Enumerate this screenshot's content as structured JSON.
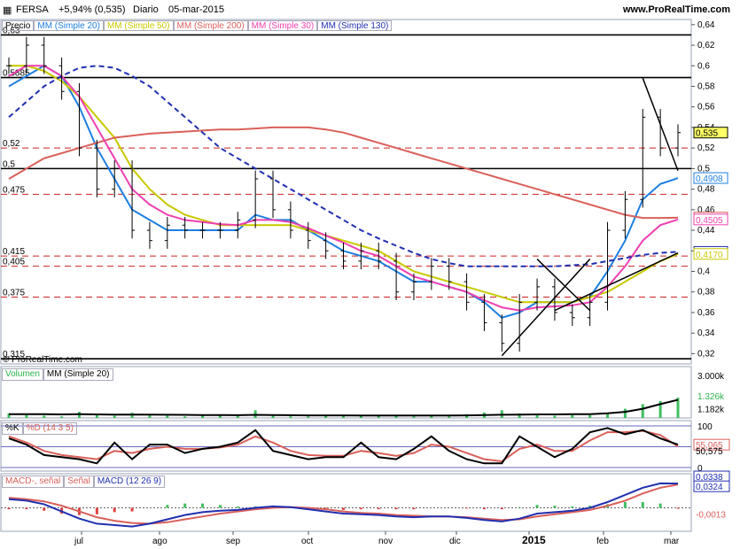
{
  "header": {
    "ticker": "FERSA",
    "change": "+5,94% (0,535)",
    "period": "Diario",
    "date": "05-mar-2015",
    "site": "www.ProRealTime.com"
  },
  "price_panel": {
    "legend": [
      "Precio",
      "MM (Simple 20)",
      "MM (Simple 50)",
      "MM (Simple 200)",
      "MM (Simple 30)",
      "MM (Simple 130)"
    ],
    "legend_colors": [
      "#000000",
      "#1e7fe0",
      "#c8c800",
      "#d9605a",
      "#ee40b0",
      "#2030b0"
    ],
    "copyright": "© ProRealTime.com",
    "level_labels": [
      "0,63",
      "0,5885",
      "0,52",
      "0,5",
      "0,475",
      "0,415",
      "0,405",
      "0,375",
      "0,315"
    ],
    "axis_ticks": [
      "0,64",
      "0,62",
      "0,6",
      "0,58",
      "0,56",
      "0,54",
      "0,52",
      "0,5",
      "0,48",
      "0,46",
      "0,44",
      "0,42",
      "0,4",
      "0,38",
      "0,36",
      "0,34",
      "0,32"
    ],
    "value_tags": [
      {
        "text": "0,535",
        "color": "#000000",
        "bg": "#ffff66"
      },
      {
        "text": "0,4908",
        "color": "#1e7fe0",
        "bg": "#ffffff"
      },
      {
        "text": "0,4523",
        "color": "#d9605a",
        "bg": "#ffffff"
      },
      {
        "text": "0,4505",
        "color": "#ee40b0",
        "bg": "#ffffff"
      },
      {
        "text": "0,4190",
        "color": "#2030b0",
        "bg": "#ffffff"
      },
      {
        "text": "0,4170",
        "color": "#c8c800",
        "bg": "#ffffff"
      }
    ]
  },
  "volume_panel": {
    "legend": [
      "Volumen",
      "MM (Simple 20)"
    ],
    "axis_ticks": [
      "3.000k"
    ],
    "value_tags": [
      "1.326k",
      "1.182k"
    ]
  },
  "stoch_panel": {
    "legend": [
      "%K",
      "%D (14 3 5)"
    ],
    "axis_ticks": [
      "100",
      "50",
      "0"
    ],
    "value_tags": [
      "55,065",
      "50,575"
    ]
  },
  "macd_panel": {
    "legend": [
      "MACD-, señal",
      "Señal",
      "MACD (12 26 9)"
    ],
    "value_tags": [
      "0,0338",
      "0,0324",
      "-0,0013"
    ]
  },
  "x_axis": {
    "labels": [
      "jul",
      "ago",
      "sep",
      "oct",
      "nov",
      "dic",
      "2015",
      "feb",
      "mar"
    ]
  },
  "chart_data": {
    "type": "line",
    "description_series": "daily close (approx.)",
    "x": [
      "2014-06-16",
      "2014-06-23",
      "2014-06-30",
      "2014-07-07",
      "2014-07-14",
      "2014-07-21",
      "2014-07-28",
      "2014-08-04",
      "2014-08-11",
      "2014-08-18",
      "2014-08-25",
      "2014-09-01",
      "2014-09-08",
      "2014-09-15",
      "2014-09-22",
      "2014-09-29",
      "2014-10-06",
      "2014-10-13",
      "2014-10-20",
      "2014-10-27",
      "2014-11-03",
      "2014-11-10",
      "2014-11-17",
      "2014-11-24",
      "2014-12-01",
      "2014-12-08",
      "2014-12-15",
      "2014-12-22",
      "2014-12-29",
      "2015-01-05",
      "2015-01-12",
      "2015-01-19",
      "2015-01-26",
      "2015-02-02",
      "2015-02-09",
      "2015-02-16",
      "2015-02-23",
      "2015-03-02",
      "2015-03-05"
    ],
    "series": [
      {
        "name": "Precio",
        "values": [
          0.6,
          0.62,
          0.6,
          0.575,
          0.52,
          0.48,
          0.5,
          0.44,
          0.43,
          0.445,
          0.44,
          0.44,
          0.44,
          0.45,
          0.49,
          0.46,
          0.44,
          0.43,
          0.42,
          0.41,
          0.42,
          0.41,
          0.38,
          0.39,
          0.405,
          0.39,
          0.37,
          0.35,
          0.33,
          0.37,
          0.385,
          0.36,
          0.355,
          0.37,
          0.44,
          0.47,
          0.55,
          0.52,
          0.535
        ]
      },
      {
        "name": "MM (Simple 20)",
        "values": [
          0.58,
          0.59,
          0.6,
          0.59,
          0.56,
          0.52,
          0.49,
          0.46,
          0.45,
          0.44,
          0.44,
          0.44,
          0.44,
          0.44,
          0.455,
          0.45,
          0.45,
          0.44,
          0.43,
          0.42,
          0.415,
          0.41,
          0.4,
          0.39,
          0.39,
          0.385,
          0.38,
          0.37,
          0.355,
          0.36,
          0.37,
          0.37,
          0.37,
          0.375,
          0.4,
          0.43,
          0.47,
          0.485,
          0.4908
        ]
      },
      {
        "name": "MM (Simple 50)",
        "values": [
          0.6,
          0.6,
          0.595,
          0.585,
          0.57,
          0.55,
          0.53,
          0.5,
          0.48,
          0.465,
          0.455,
          0.45,
          0.445,
          0.445,
          0.445,
          0.445,
          0.445,
          0.44,
          0.435,
          0.43,
          0.425,
          0.42,
          0.41,
          0.4,
          0.395,
          0.39,
          0.385,
          0.38,
          0.375,
          0.37,
          0.37,
          0.37,
          0.37,
          0.375,
          0.38,
          0.39,
          0.4,
          0.41,
          0.417
        ]
      },
      {
        "name": "MM (Simple 200)",
        "values": [
          0.49,
          0.5,
          0.51,
          0.515,
          0.52,
          0.525,
          0.53,
          0.532,
          0.534,
          0.535,
          0.536,
          0.537,
          0.538,
          0.538,
          0.539,
          0.54,
          0.54,
          0.54,
          0.538,
          0.535,
          0.53,
          0.525,
          0.52,
          0.515,
          0.51,
          0.505,
          0.5,
          0.495,
          0.49,
          0.485,
          0.48,
          0.475,
          0.47,
          0.465,
          0.46,
          0.455,
          0.452,
          0.452,
          0.4523
        ]
      },
      {
        "name": "MM (Simple 30)",
        "values": [
          0.59,
          0.6,
          0.6,
          0.59,
          0.57,
          0.54,
          0.51,
          0.48,
          0.465,
          0.455,
          0.45,
          0.448,
          0.446,
          0.445,
          0.45,
          0.45,
          0.448,
          0.442,
          0.435,
          0.428,
          0.42,
          0.415,
          0.405,
          0.395,
          0.39,
          0.385,
          0.38,
          0.372,
          0.365,
          0.362,
          0.365,
          0.366,
          0.367,
          0.37,
          0.385,
          0.405,
          0.43,
          0.445,
          0.4505
        ]
      },
      {
        "name": "MM (Simple 130)",
        "values": [
          0.55,
          0.565,
          0.58,
          0.59,
          0.598,
          0.6,
          0.598,
          0.59,
          0.58,
          0.565,
          0.55,
          0.535,
          0.52,
          0.51,
          0.5,
          0.49,
          0.48,
          0.47,
          0.46,
          0.45,
          0.44,
          0.432,
          0.425,
          0.418,
          0.412,
          0.408,
          0.405,
          0.405,
          0.405,
          0.405,
          0.405,
          0.405,
          0.406,
          0.407,
          0.41,
          0.413,
          0.416,
          0.418,
          0.419
        ]
      }
    ],
    "ylim": [
      0.31,
      0.645
    ],
    "horizontal_levels": [
      0.63,
      0.5885,
      0.52,
      0.5,
      0.475,
      0.415,
      0.405,
      0.375,
      0.315
    ],
    "volume_values_k": [
      300,
      200,
      150,
      100,
      400,
      250,
      150,
      350,
      200,
      150,
      100,
      150,
      200,
      120,
      500,
      150,
      100,
      100,
      180,
      150,
      120,
      200,
      150,
      100,
      130,
      100,
      250,
      350,
      500,
      300,
      250,
      150,
      200,
      180,
      300,
      600,
      900,
      1100,
      1326
    ],
    "volume_ma_k": [
      250,
      250,
      240,
      230,
      240,
      230,
      220,
      220,
      220,
      210,
      200,
      190,
      190,
      180,
      200,
      190,
      180,
      170,
      170,
      170,
      160,
      160,
      160,
      160,
      160,
      160,
      170,
      190,
      210,
      220,
      230,
      230,
      240,
      250,
      300,
      400,
      600,
      900,
      1182
    ],
    "stoch_k": [
      70,
      55,
      30,
      25,
      20,
      10,
      60,
      20,
      55,
      55,
      35,
      45,
      50,
      60,
      90,
      40,
      30,
      20,
      25,
      25,
      60,
      25,
      20,
      45,
      75,
      40,
      20,
      10,
      10,
      75,
      50,
      25,
      45,
      85,
      95,
      80,
      90,
      70,
      55.065
    ],
    "stoch_d": [
      75,
      60,
      40,
      30,
      25,
      20,
      40,
      35,
      45,
      50,
      45,
      45,
      48,
      55,
      75,
      60,
      40,
      30,
      28,
      28,
      40,
      35,
      28,
      35,
      55,
      50,
      35,
      20,
      15,
      45,
      55,
      40,
      40,
      65,
      85,
      85,
      88,
      78,
      50.575
    ],
    "macd": [
      0.012,
      0.01,
      0.005,
      -0.005,
      -0.015,
      -0.022,
      -0.024,
      -0.026,
      -0.022,
      -0.016,
      -0.01,
      -0.006,
      -0.004,
      -0.003,
      0.0,
      0.002,
      0.001,
      -0.002,
      -0.005,
      -0.008,
      -0.009,
      -0.01,
      -0.012,
      -0.013,
      -0.012,
      -0.012,
      -0.014,
      -0.017,
      -0.019,
      -0.015,
      -0.008,
      -0.006,
      -0.004,
      0.0,
      0.008,
      0.018,
      0.028,
      0.034,
      0.0338
    ],
    "macd_signal": [
      0.014,
      0.012,
      0.009,
      0.003,
      -0.005,
      -0.013,
      -0.018,
      -0.021,
      -0.022,
      -0.02,
      -0.016,
      -0.012,
      -0.008,
      -0.005,
      -0.002,
      0.0,
      0.001,
      0.0,
      -0.002,
      -0.005,
      -0.007,
      -0.008,
      -0.01,
      -0.011,
      -0.012,
      -0.012,
      -0.013,
      -0.015,
      -0.017,
      -0.016,
      -0.012,
      -0.009,
      -0.006,
      -0.003,
      0.003,
      0.01,
      0.02,
      0.028,
      0.0324
    ],
    "macd_hist": [
      -0.002,
      -0.002,
      -0.004,
      -0.008,
      -0.01,
      -0.009,
      -0.006,
      -0.005,
      0.0,
      0.004,
      0.006,
      0.006,
      0.004,
      0.002,
      0.002,
      0.002,
      0.0,
      -0.002,
      -0.003,
      -0.003,
      -0.002,
      -0.002,
      -0.002,
      -0.002,
      0.0,
      0.0,
      -0.001,
      -0.002,
      -0.002,
      0.001,
      0.004,
      0.003,
      0.002,
      0.003,
      0.005,
      0.008,
      0.008,
      0.006,
      -0.0013
    ]
  }
}
